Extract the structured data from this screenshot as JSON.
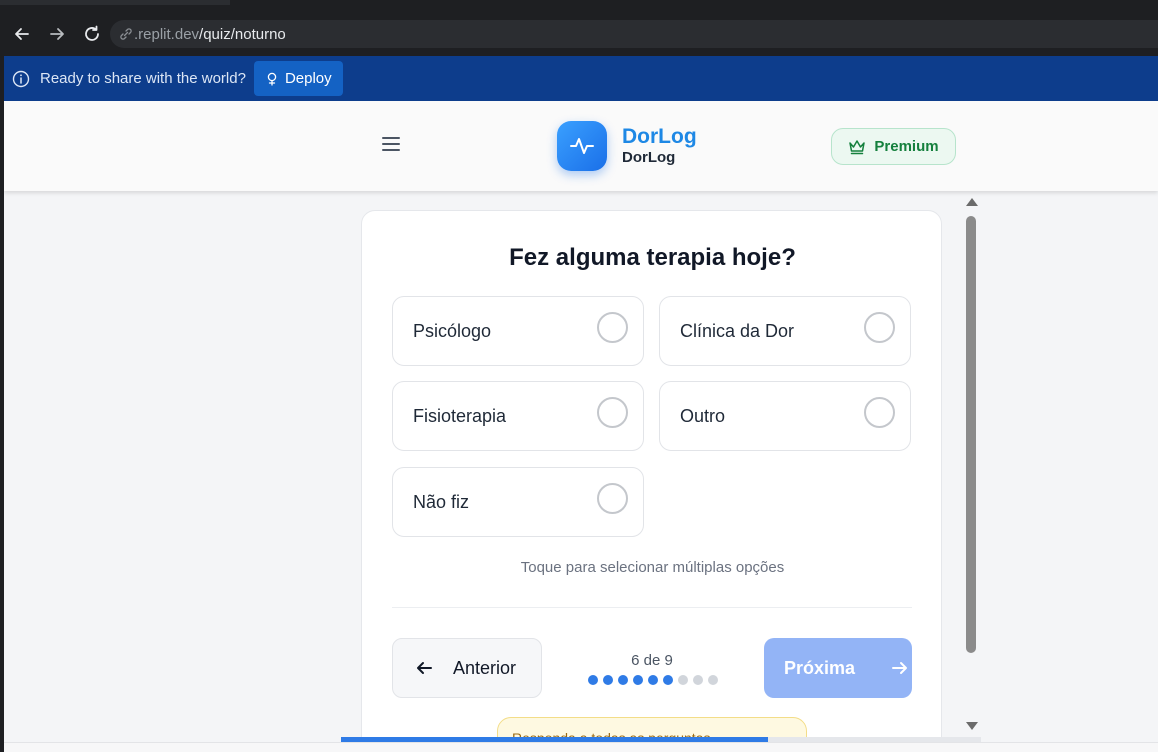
{
  "browser": {
    "url_host": ".replit.dev",
    "url_path": "/quiz/noturno"
  },
  "banner": {
    "message": "Ready to share with the world?",
    "deploy_label": "Deploy"
  },
  "header": {
    "brand_title": "DorLog",
    "brand_subtitle": "DorLog",
    "premium_label": "Premium"
  },
  "quiz": {
    "question": "Fez alguma terapia hoje?",
    "options": [
      {
        "label": "Psicólogo",
        "selected": false
      },
      {
        "label": "Clínica da Dor",
        "selected": false
      },
      {
        "label": "Fisioterapia",
        "selected": false
      },
      {
        "label": "Outro",
        "selected": false
      },
      {
        "label": "Não fiz",
        "selected": false
      }
    ],
    "hint": "Toque para selecionar múltiplas opções",
    "prev_label": "Anterior",
    "next_label": "Próxima",
    "progress_text": "6 de 9",
    "progress_current": 6,
    "progress_total": 9,
    "notice_text": "Responda a todas as perguntas"
  },
  "colors": {
    "accent": "#2f7be6",
    "banner": "#0d3d8c",
    "premium": "#15803d"
  }
}
